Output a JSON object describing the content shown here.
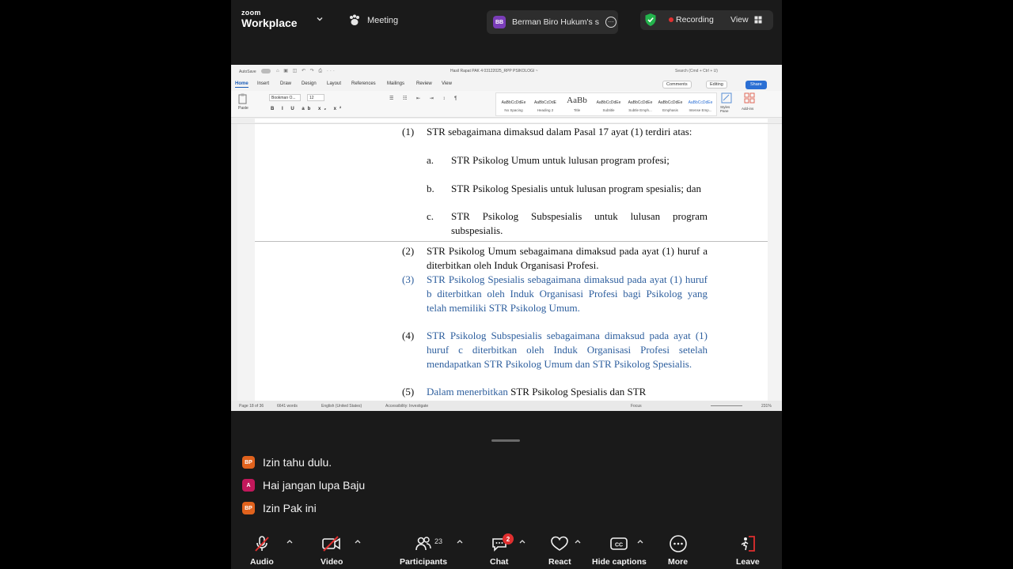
{
  "topbar": {
    "logo_line1": "zoom",
    "logo_line2": "Workplace",
    "meeting_label": "Meeting",
    "sharer_initials": "BB",
    "sharer_name": "Berman Biro Hukum's s",
    "recording_label": "Recording",
    "view_label": "View"
  },
  "word": {
    "autosave_label": "AutoSave",
    "doc_title": "Hasil Rapat PAK 4 03122025_RPP PSIKOLOGI ~",
    "search_placeholder": "Search (Cmd + Ctrl + U)",
    "tabs": [
      "Home",
      "Insert",
      "Draw",
      "Design",
      "Layout",
      "References",
      "Mailings",
      "Review",
      "View"
    ],
    "comments_label": "Comments",
    "editing_label": "Editing",
    "share_label": "Share",
    "paste_label": "Paste",
    "font_name": "Bookman O...",
    "font_size": "12",
    "styles": [
      {
        "sample": "AaBbCcDdEe",
        "name": "No Spacing"
      },
      {
        "sample": "AaBbCcDdE",
        "name": "Heading 2"
      },
      {
        "sample": "AaBb",
        "name": "Title"
      },
      {
        "sample": "AaBbCcDdEe",
        "name": "Subtitle"
      },
      {
        "sample": "AaBbCcDdEe",
        "name": "Subtle Emph..."
      },
      {
        "sample": "AaBbCcDdEe",
        "name": "Emphasis"
      },
      {
        "sample": "AaBbCcDdEe",
        "name": "Intense Emp..."
      }
    ],
    "styles_pane_label": "Styles Pane",
    "addins_label": "Add-ins",
    "status": {
      "page": "Page 18 of 36",
      "words": "6641 words",
      "language": "English (United States)",
      "accessibility": "Accessibility: Investigate",
      "focus": "Focus",
      "zoom": "231%"
    }
  },
  "document": {
    "p1_num": "(1)",
    "p1_text": "STR sebagaimana dimaksud dalam Pasal 17 ayat (1) terdiri atas:",
    "items": [
      {
        "num": "a.",
        "text": "STR Psikolog Umum untuk lulusan program profesi;"
      },
      {
        "num": "b.",
        "text": "STR Psikolog Spesialis untuk lulusan program spesialis; dan"
      },
      {
        "num": "c.",
        "text": "STR Psikolog Subspesialis untuk lulusan program subspesialis."
      }
    ],
    "p2_num": "(2)",
    "p2_text": "STR Psikolog Umum sebagaimana dimaksud pada ayat (1) huruf a diterbitkan oleh Induk Organisasi Profesi.",
    "p3_num": "(3)",
    "p3_text": "STR Psikolog Spesialis sebagaimana dimaksud pada ayat (1) huruf b diterbitkan oleh Induk Organisasi Profesi bagi Psikolog yang telah memiliki STR Psikolog Umum.",
    "p4_num": "(4)",
    "p4_text": "STR Psikolog Subspesialis sebagaimana dimaksud pada ayat (1) huruf c diterbitkan oleh Induk Organisasi Profesi setelah mendapatkan STR Psikolog Umum dan STR Psikolog Spesialis.",
    "p5_num": "(5)",
    "p5_text_blue": "Dalam menerbitkan",
    "p5_text_black": " STR Psikolog Spesialis dan STR"
  },
  "chat": [
    {
      "initials": "BP",
      "message": "Izin tahu dulu."
    },
    {
      "initials": "A",
      "message": "Hai jangan lupa Baju"
    },
    {
      "initials": "BP",
      "message": "Izin Pak ini"
    }
  ],
  "toolbar": {
    "audio": "Audio",
    "video": "Video",
    "participants": "Participants",
    "participants_count": "23",
    "chat": "Chat",
    "chat_badge": "2",
    "react": "React",
    "captions": "Hide captions",
    "more": "More",
    "leave": "Leave"
  },
  "colors": {
    "zoom_bg": "#1a1a1a",
    "tracked_change_blue": "#2e5f9e",
    "recording_red": "#e03131",
    "word_accent": "#2b6fd4"
  }
}
